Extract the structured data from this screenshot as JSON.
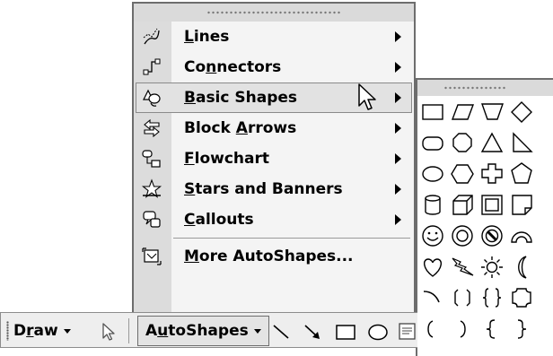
{
  "autoshapes_menu": {
    "items": [
      {
        "label": "Lines",
        "accel": "L",
        "accel_index": 0,
        "submenu": true,
        "icon": "lines-icon"
      },
      {
        "label": "Connectors",
        "accel": "n",
        "accel_index": 2,
        "submenu": true,
        "icon": "connectors-icon"
      },
      {
        "label": "Basic Shapes",
        "accel": "B",
        "accel_index": 0,
        "submenu": true,
        "icon": "basic-shapes-icon",
        "highlighted": true
      },
      {
        "label": "Block Arrows",
        "accel": "A",
        "accel_index": 6,
        "submenu": true,
        "icon": "block-arrows-icon"
      },
      {
        "label": "Flowchart",
        "accel": "F",
        "accel_index": 0,
        "submenu": true,
        "icon": "flowchart-icon"
      },
      {
        "label": "Stars and Banners",
        "accel": "S",
        "accel_index": 0,
        "submenu": true,
        "icon": "stars-banners-icon"
      },
      {
        "label": "Callouts",
        "accel": "C",
        "accel_index": 0,
        "submenu": true,
        "icon": "callouts-icon"
      }
    ],
    "more": {
      "label": "More AutoShapes...",
      "accel": "M",
      "accel_index": 0,
      "icon": "more-autoshapes-icon"
    }
  },
  "basic_shapes_palette": {
    "shapes": [
      "rectangle",
      "parallelogram",
      "trapezoid",
      "diamond",
      "rounded-rectangle",
      "octagon",
      "isosceles-triangle",
      "right-triangle",
      "oval",
      "hexagon",
      "cross",
      "pentagon",
      "can",
      "cube",
      "bevel",
      "folded-corner",
      "smiley-face",
      "donut",
      "no-symbol",
      "block-arc",
      "heart",
      "lightning-bolt",
      "sun",
      "moon",
      "arc",
      "double-bracket",
      "double-brace",
      "plaque",
      "left-bracket",
      "right-bracket",
      "left-brace",
      "right-brace"
    ]
  },
  "drawing_toolbar": {
    "draw": {
      "label": "Draw",
      "accel": "r",
      "accel_index": 1
    },
    "autoshapes": {
      "label": "AutoShapes",
      "accel": "u",
      "accel_index": 1
    },
    "tools": [
      "select-objects-icon",
      "line-icon",
      "arrow-icon",
      "rectangle-icon",
      "oval-icon",
      "text-box-icon"
    ]
  }
}
